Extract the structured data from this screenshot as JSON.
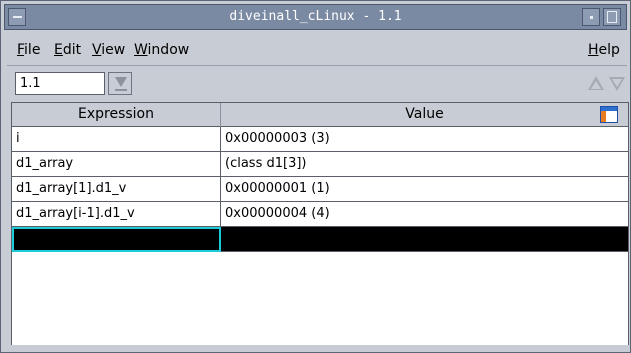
{
  "window": {
    "title": "diveinall_cLinux - 1.1"
  },
  "menubar": {
    "file": "File",
    "edit": "Edit",
    "view": "View",
    "window": "Window",
    "help": "Help"
  },
  "toolbar": {
    "thread_value": "1.1"
  },
  "table": {
    "headers": {
      "expression": "Expression",
      "value": "Value"
    },
    "rows": [
      {
        "expression": "i",
        "value": "0x00000003 (3)"
      },
      {
        "expression": "d1_array",
        "value": "(class d1[3])"
      },
      {
        "expression": "d1_array[1].d1_v",
        "value": "0x00000001 (1)"
      },
      {
        "expression": "d1_array[i-1].d1_v",
        "value": "0x00000004 (4)"
      },
      {
        "expression": "",
        "value": ""
      }
    ]
  }
}
